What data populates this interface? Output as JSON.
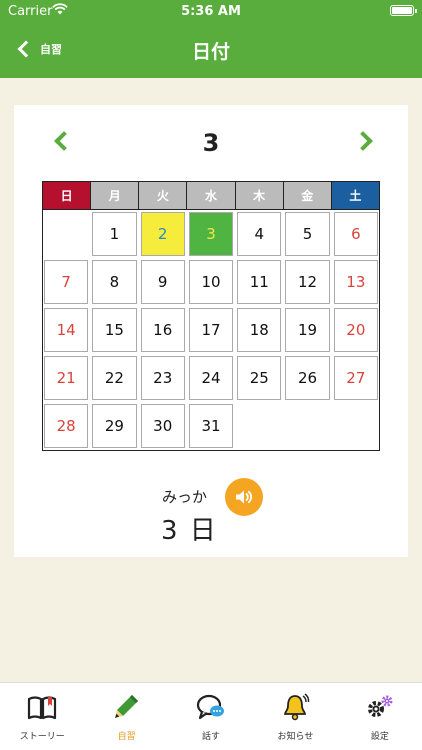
{
  "status_bar": {
    "carrier": "Carrier",
    "time": "5:36 AM"
  },
  "nav_bar": {
    "back_label": "自習",
    "title": "日付"
  },
  "calendar": {
    "month": "3",
    "weekdays": [
      "日",
      "月",
      "火",
      "水",
      "木",
      "金",
      "土"
    ],
    "days": [
      [
        "",
        "1",
        "2",
        "3",
        "4",
        "5",
        "6"
      ],
      [
        "7",
        "8",
        "9",
        "10",
        "11",
        "12",
        "13"
      ],
      [
        "14",
        "15",
        "16",
        "17",
        "18",
        "19",
        "20"
      ],
      [
        "21",
        "22",
        "23",
        "24",
        "25",
        "26",
        "27"
      ],
      [
        "28",
        "29",
        "30",
        "31",
        "",
        "",
        ""
      ]
    ],
    "highlight_yellow_day": "2",
    "highlight_green_day": "3",
    "colors": {
      "sunday_header": "#b5112f",
      "saturday_header": "#1b5fa0",
      "weekday_header": "#bbbbbb",
      "weekend_text": "#d9433b",
      "yellow": "#f5ec3b",
      "green": "#4fb441"
    }
  },
  "detail": {
    "reading": "みっか",
    "date_text": "3 日"
  },
  "tabbar": {
    "items": [
      {
        "label": "ストーリー",
        "icon": "book-icon"
      },
      {
        "label": "自習",
        "icon": "pencil-icon",
        "active": true
      },
      {
        "label": "話す",
        "icon": "chat-bubble-icon"
      },
      {
        "label": "お知らせ",
        "icon": "bell-icon"
      },
      {
        "label": "設定",
        "icon": "gear-icon"
      }
    ]
  },
  "theme": {
    "primary_green": "#58ad3c",
    "background": "#f4f1e3",
    "accent_orange": "#f4a623"
  }
}
